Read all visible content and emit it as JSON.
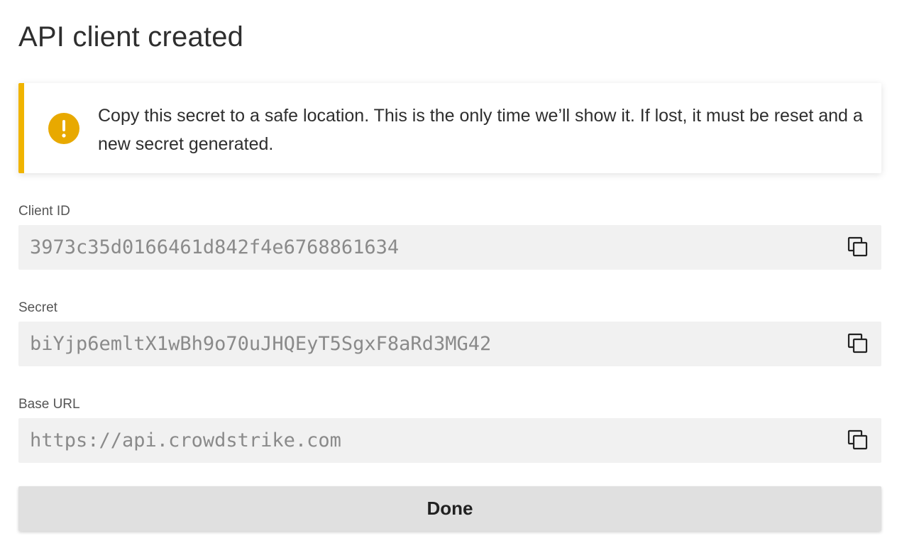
{
  "dialog": {
    "title": "API client created"
  },
  "alert": {
    "icon": "exclamation-icon",
    "accent_color": "#f0b400",
    "message": "Copy this secret to a safe location. This is the only time we’ll show it. If lost, it must be reset and a new secret generated."
  },
  "fields": {
    "client_id": {
      "label": "Client ID",
      "value": "3973c35d0166461d842f4e6768861634",
      "copy_icon": "copy-icon"
    },
    "secret": {
      "label": "Secret",
      "value": "biYjp6emltX1wBh9o70uJHQEyT5SgxF8aRd3MG42",
      "copy_icon": "copy-icon"
    },
    "base_url": {
      "label": "Base URL",
      "value": "https://api.crowdstrike.com",
      "copy_icon": "copy-icon"
    }
  },
  "actions": {
    "done_label": "Done"
  }
}
